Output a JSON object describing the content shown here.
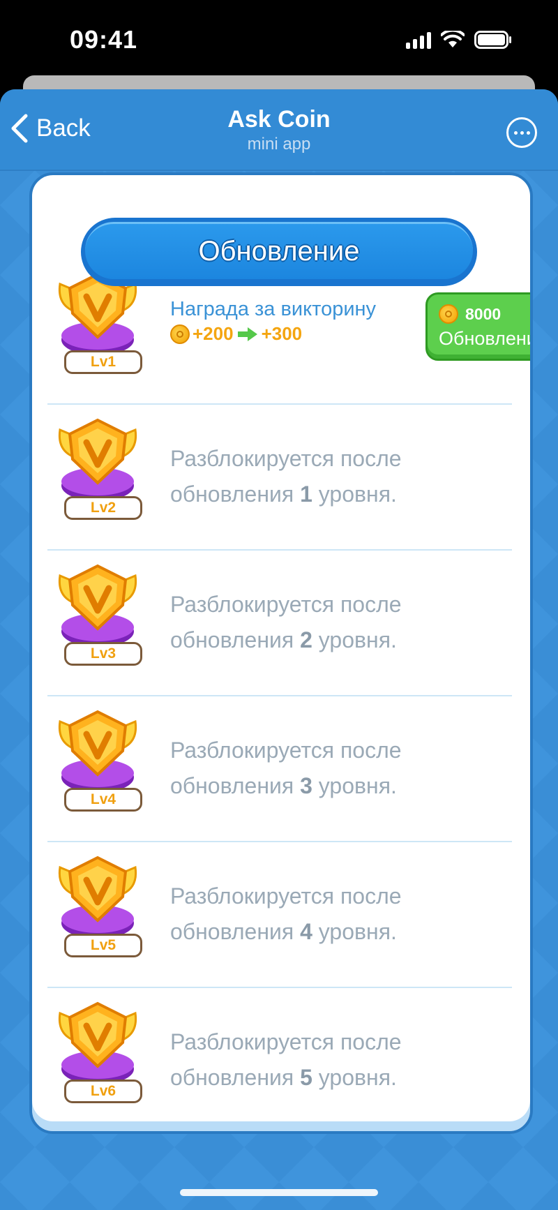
{
  "status_bar": {
    "time": "09:41"
  },
  "header": {
    "back_label": "Back",
    "title": "Ask Coin",
    "subtitle": "mini app"
  },
  "banner": {
    "title": "Обновление"
  },
  "levels": [
    {
      "label": "Lv1",
      "reward_title": "Награда за викторину",
      "reward_from": "+200",
      "reward_to": "+300",
      "upgrade_cost": "8000",
      "upgrade_label": "Обновление"
    },
    {
      "label": "Lv2",
      "locked_prefix": "Разблокируется после обновления",
      "required_level": "1",
      "locked_suffix": "уровня."
    },
    {
      "label": "Lv3",
      "locked_prefix": "Разблокируется после обновления",
      "required_level": "2",
      "locked_suffix": "уровня."
    },
    {
      "label": "Lv4",
      "locked_prefix": "Разблокируется после обновления",
      "required_level": "3",
      "locked_suffix": "уровня."
    },
    {
      "label": "Lv5",
      "locked_prefix": "Разблокируется после обновления",
      "required_level": "4",
      "locked_suffix": "уровня."
    },
    {
      "label": "Lv6",
      "locked_prefix": "Разблокируется после обновления",
      "required_level": "5",
      "locked_suffix": "уровня."
    }
  ],
  "icons": {
    "back": "chevron-left-icon",
    "more": "more-icon",
    "badge": "v-badge-icon",
    "coin": "coin-icon",
    "arrow": "arrow-right-icon"
  },
  "colors": {
    "accent": "#338bd5",
    "upgrade_green": "#5dcf4d",
    "reward_gold": "#f4a510",
    "locked_text": "#9aa9b6"
  }
}
